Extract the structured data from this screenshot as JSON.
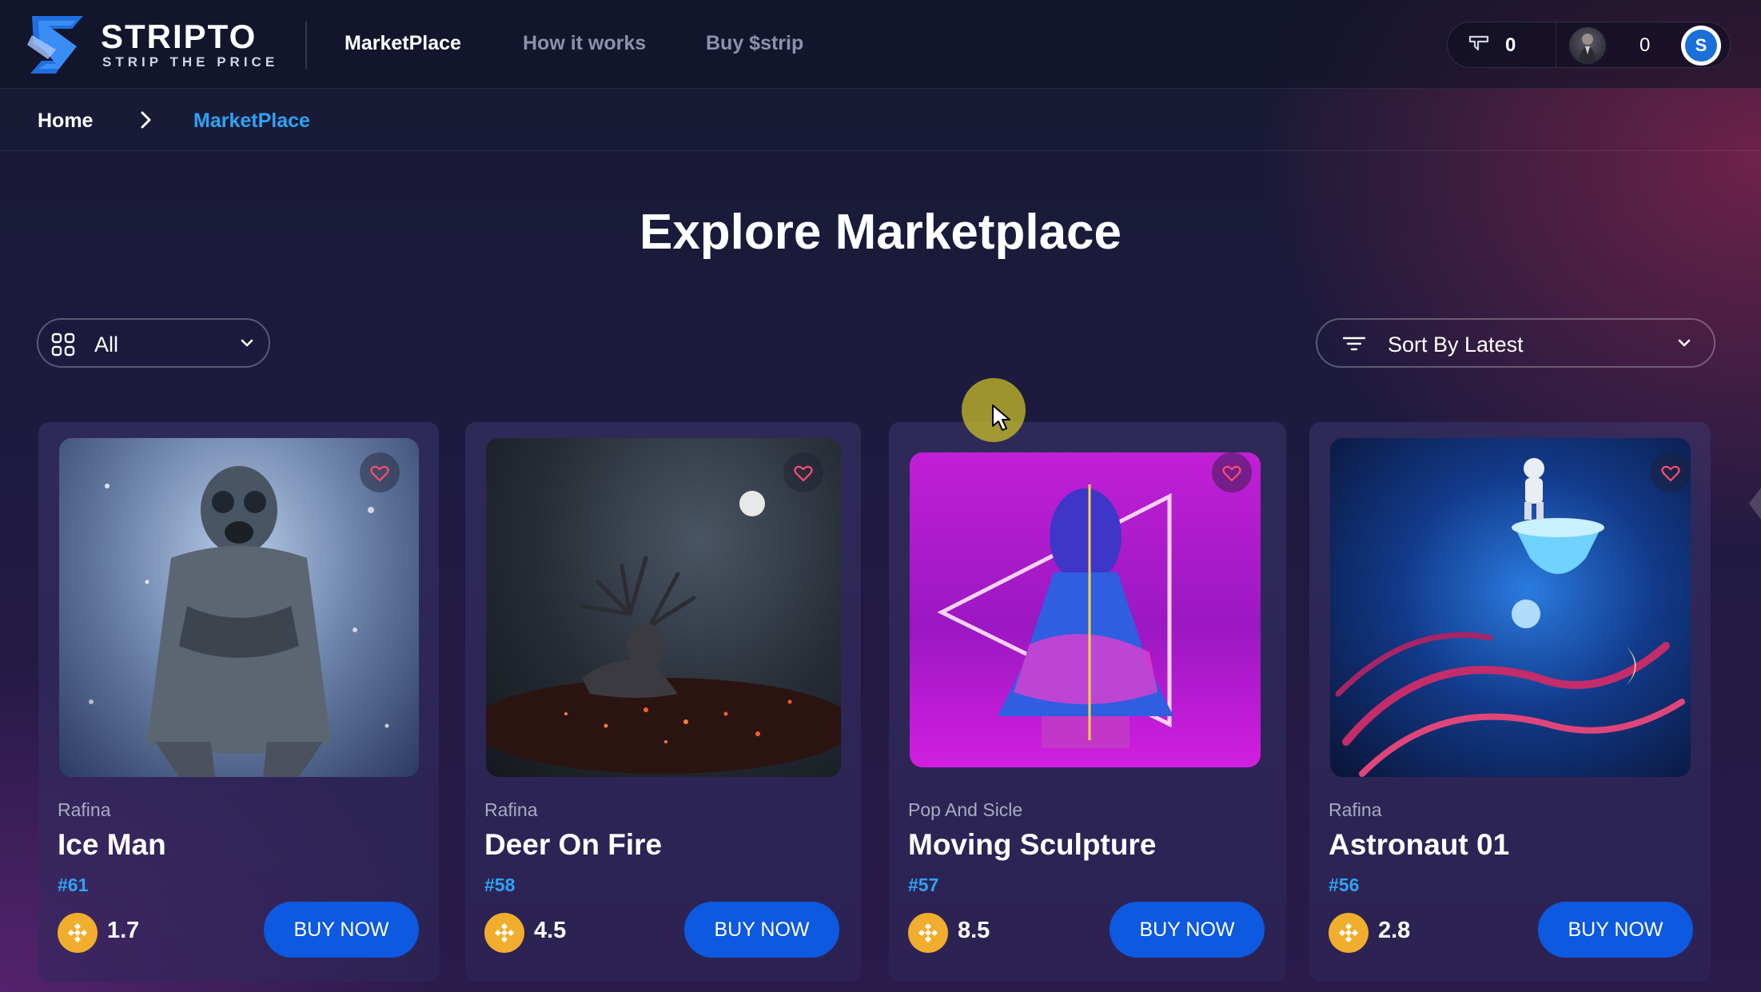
{
  "brand": {
    "name": "STRIPTO",
    "tagline": "STRIP THE PRICE"
  },
  "nav": [
    {
      "label": "MarketPlace",
      "active": true
    },
    {
      "label": "How it works",
      "active": false
    },
    {
      "label": "Buy $strip",
      "active": false
    }
  ],
  "header_right": {
    "message_count": "0",
    "balance": "0",
    "logo_letter": "S"
  },
  "breadcrumb": {
    "home": "Home",
    "current": "MarketPlace"
  },
  "page_title": "Explore Marketplace",
  "filters": {
    "category": "All",
    "sort": "Sort By Latest"
  },
  "cards": [
    {
      "creator": "Rafina",
      "title": "Ice Man",
      "token": "#61",
      "price": "1.7",
      "button": "BUY NOW"
    },
    {
      "creator": "Rafina",
      "title": "Deer On Fire",
      "token": "#58",
      "price": "4.5",
      "button": "BUY NOW"
    },
    {
      "creator": "Pop And Sicle",
      "title": "Moving Sculpture",
      "token": "#57",
      "price": "8.5",
      "button": "BUY NOW"
    },
    {
      "creator": "Rafina",
      "title": "Astronaut 01",
      "token": "#56",
      "price": "2.8",
      "button": "BUY NOW"
    }
  ],
  "colors": {
    "accent": "#2ea3f2",
    "button": "#0d59df",
    "coin": "#f1ad2d",
    "like": "#ff4d6d"
  },
  "icons": [
    "message-icon",
    "heart-icon",
    "grid-icon",
    "filter-lines-icon",
    "chevron-down-icon",
    "chevron-right-icon",
    "bnb-coin-icon"
  ]
}
